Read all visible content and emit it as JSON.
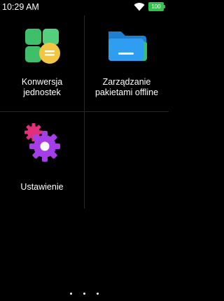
{
  "status_bar": {
    "time": "10:29 AM",
    "battery": "100",
    "battery_color": "#33c24d"
  },
  "tiles": [
    {
      "label_line1": "Konwersja",
      "label_line2": "jednostek",
      "icon": "unit-conversion-icon"
    },
    {
      "label_line1": "Zarządzanie",
      "label_line2": "pakietami offline",
      "icon": "folder-icon"
    },
    {
      "label": "Ustawienie",
      "icon": "settings-gear-icon"
    }
  ],
  "colors": {
    "background": "#000000",
    "divider": "#262626",
    "folder_blue": "#2f9df0",
    "gear_purple": "#a63ee8"
  }
}
